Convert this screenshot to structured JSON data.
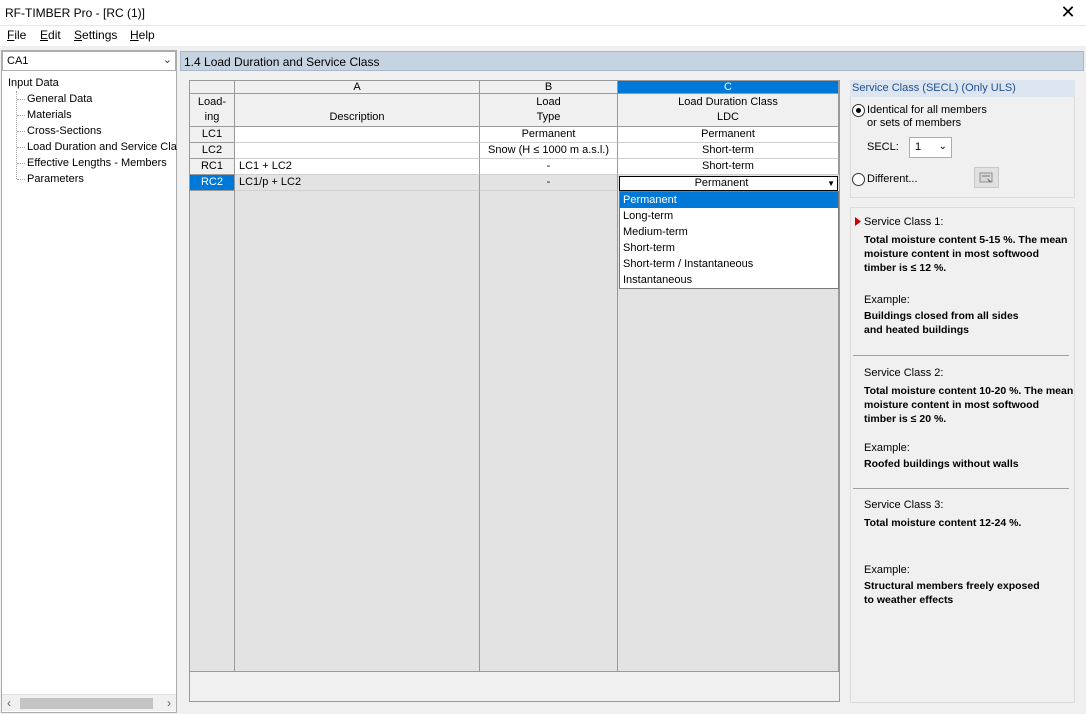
{
  "window": {
    "title": "RF-TIMBER Pro - [RC (1)]",
    "close": "✕"
  },
  "menu": [
    {
      "key": "F",
      "rest": "ile"
    },
    {
      "key": "E",
      "rest": "dit"
    },
    {
      "key": "S",
      "rest": "ettings"
    },
    {
      "key": "H",
      "rest": "elp"
    }
  ],
  "case_select": {
    "value": "CA1"
  },
  "tree": {
    "root": "Input Data",
    "items": [
      "General Data",
      "Materials",
      "Cross-Sections",
      "Load Duration and Service Clas",
      "Effective Lengths - Members",
      "Parameters"
    ]
  },
  "section_title": "1.4 Load Duration and Service Class",
  "grid": {
    "corner": {
      "l1": "Load-",
      "l2": "ing"
    },
    "columns": [
      {
        "letter": "A",
        "h1": "",
        "h2": "Description"
      },
      {
        "letter": "B",
        "h1": "Load",
        "h2": "Type"
      },
      {
        "letter": "C",
        "h1": "Load Duration Class",
        "h2": "LDC"
      }
    ],
    "rows": [
      {
        "id": "LC1",
        "desc": "",
        "type": "Permanent",
        "ldc": "Permanent"
      },
      {
        "id": "LC2",
        "desc": "",
        "type": "Snow (H ≤ 1000 m a.s.l.)",
        "ldc": "Short-term"
      },
      {
        "id": "RC1",
        "desc": "LC1 + LC2",
        "type": "-",
        "ldc": "Short-term"
      },
      {
        "id": "RC2",
        "desc": "LC1/p + LC2",
        "type": "-",
        "ldc": "Permanent"
      }
    ],
    "dropdown_options": [
      "Permanent",
      "Long-term",
      "Medium-term",
      "Short-term",
      "Short-term / Instantaneous",
      "Instantaneous"
    ],
    "selected_option": "Permanent"
  },
  "secl": {
    "title": "Service Class (SECL) (Only ULS)",
    "identical_l1": "Identical for all members",
    "identical_l2": "or sets of members",
    "secl_label": "SECL:",
    "secl_value": "1",
    "different_label": "Different..."
  },
  "info": {
    "sc1_title": "Service Class 1:",
    "sc1_l1": "Total moisture content 5-15 %. The mean",
    "sc1_l2": "moisture content in most softwood",
    "sc1_l3": "timber is ≤ 12 %.",
    "sc1_ex": "Example:",
    "sc1_e1": "Buildings closed from all sides",
    "sc1_e2": "and heated buildings",
    "sc2_title": "Service Class 2:",
    "sc2_l1": "Total moisture content 10-20 %. The mean",
    "sc2_l2": "moisture content in most softwood",
    "sc2_l3": "timber is ≤ 20 %.",
    "sc2_ex": "Example:",
    "sc2_e1": "Roofed buildings without walls",
    "sc3_title": "Service Class 3:",
    "sc3_l1": "Total moisture content 12-24 %.",
    "sc3_ex": "Example:",
    "sc3_e1": "Structural members freely exposed",
    "sc3_e2": "to weather effects"
  }
}
